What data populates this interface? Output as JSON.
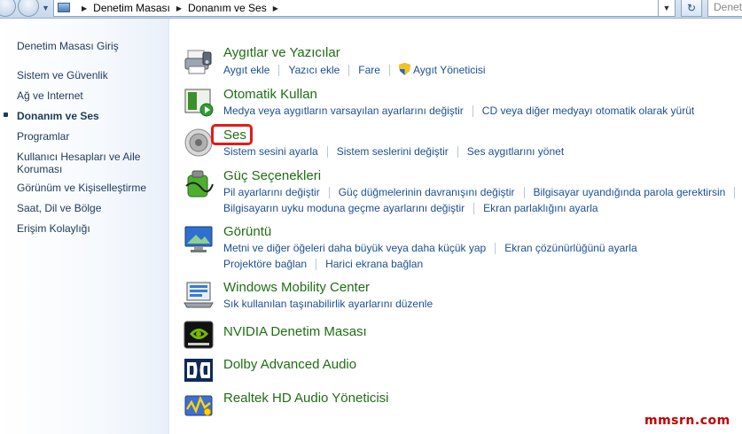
{
  "address_bar": {
    "breadcrumbs": [
      "Denetim Masası",
      "Donanım ve Ses"
    ],
    "search_placeholder": "Denetim"
  },
  "sidebar": {
    "items": [
      {
        "label": "Denetim Masası Giriş",
        "active": false
      },
      {
        "label": "Sistem ve Güvenlik",
        "active": false
      },
      {
        "label": "Ağ ve Internet",
        "active": false
      },
      {
        "label": "Donanım ve Ses",
        "active": true
      },
      {
        "label": "Programlar",
        "active": false
      },
      {
        "label": "Kullanıcı Hesapları ve Aile Koruması",
        "active": false
      },
      {
        "label": "Görünüm ve Kişiselleştirme",
        "active": false
      },
      {
        "label": "Saat, Dil ve Bölge",
        "active": false
      },
      {
        "label": "Erişim Kolaylığı",
        "active": false
      }
    ]
  },
  "categories": [
    {
      "title": "Aygıtlar ve Yazıcılar",
      "icon": "printer-icon",
      "links": [
        [
          "Aygıt ekle",
          "Yazıcı ekle",
          "Fare",
          "Aygıt Yöneticisi"
        ]
      ]
    },
    {
      "title": "Otomatik Kullan",
      "icon": "autoplay-icon",
      "links": [
        [
          "Medya veya aygıtların varsayılan ayarlarını değiştir",
          "CD veya diğer medyayı otomatik olarak yürüt"
        ]
      ]
    },
    {
      "title": "Ses",
      "icon": "speaker-icon",
      "links": [
        [
          "Sistem sesini ayarla",
          "Sistem seslerini değiştir",
          "Ses aygıtlarını yönet"
        ]
      ]
    },
    {
      "title": "Güç Seçenekleri",
      "icon": "power-options-icon",
      "links": [
        [
          "Pil ayarlarını değiştir",
          "Güç düğmelerinin davranışını değiştir",
          "Bilgisayar uyandığında parola gerektirsin"
        ],
        [
          "Bilgisayarın uyku moduna geçme ayarlarını değiştir",
          "Ekran parlaklığını ayarla"
        ]
      ]
    },
    {
      "title": "Görüntü",
      "icon": "display-icon",
      "links": [
        [
          "Metni ve diğer öğeleri daha büyük veya daha küçük yap",
          "Ekran çözünürlüğünü ayarla"
        ],
        [
          "Projektöre bağlan",
          "Harici ekrana bağlan"
        ]
      ]
    },
    {
      "title": "Windows Mobility Center",
      "icon": "mobility-center-icon",
      "links": [
        [
          "Sık kullanılan taşınabilirlik ayarlarını düzenle"
        ]
      ]
    },
    {
      "title": "NVIDIA Denetim Masası",
      "icon": "nvidia-icon",
      "links": []
    },
    {
      "title": "Dolby Advanced Audio",
      "icon": "dolby-icon",
      "links": []
    },
    {
      "title": "Realtek HD Audio Yöneticisi",
      "icon": "realtek-icon",
      "links": []
    }
  ],
  "watermark": "mmsrn.com",
  "colors": {
    "category_title": "#1e6e12",
    "link": "#1b4f93",
    "highlight": "#e31b1b"
  }
}
